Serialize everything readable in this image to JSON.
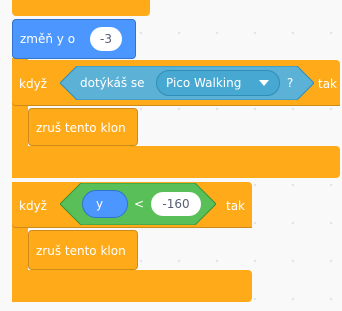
{
  "script": {
    "change_block": {
      "label": "změň y o",
      "value": "-3"
    },
    "if_touching": {
      "if_label": "když",
      "sensing_label": "dotýkáš se",
      "sprite_option": "Pico Walking",
      "question_mark": "?",
      "then_label": "tak",
      "body_block": "zruš tento klon"
    },
    "if_compare": {
      "if_label": "když",
      "left_reporter": "y",
      "operator": "<",
      "right_value": "-160",
      "then_label": "tak",
      "body_block": "zruš tento klon"
    }
  },
  "colors": {
    "motion_blue": "#4c97ff",
    "control_orange": "#ffab19",
    "sensing_cyan": "#5cb1d6",
    "operator_green": "#59c059"
  }
}
